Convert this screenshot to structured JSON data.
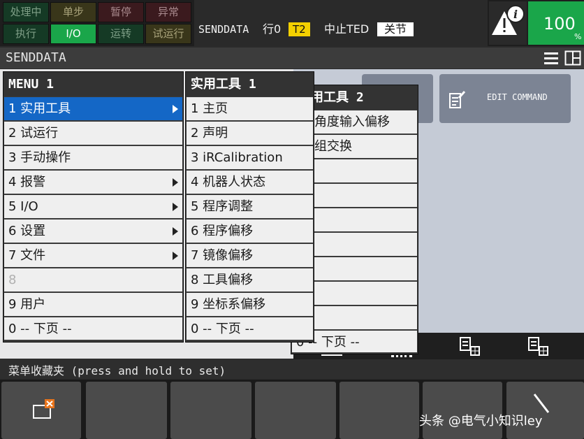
{
  "status": {
    "leds": [
      {
        "label": "处理中",
        "state": "off",
        "color": "green"
      },
      {
        "label": "单步",
        "state": "off",
        "color": "yellow"
      },
      {
        "label": "暂停",
        "state": "off",
        "color": "red"
      },
      {
        "label": "异常",
        "state": "off",
        "color": "red"
      },
      {
        "label": "执行",
        "state": "off",
        "color": "green"
      },
      {
        "label": "I/O",
        "state": "on",
        "color": "green"
      },
      {
        "label": "运转",
        "state": "off",
        "color": "green"
      },
      {
        "label": "试运行",
        "state": "off",
        "color": "yellow"
      }
    ],
    "program": "SENDDATA",
    "line": "行0",
    "mode": "T2",
    "state": "中止TED",
    "joint": "关节",
    "override": "100",
    "override_unit": "%"
  },
  "title": "SENDDATA",
  "menu": {
    "header": "MENU  1",
    "items": [
      "1 实用工具",
      "2 试运行",
      "3 手动操作",
      "4 报警",
      "5 I/O",
      "6 设置",
      "7 文件",
      "8",
      "9 用户",
      "0 -- 下页 --"
    ]
  },
  "submenu1": {
    "header": "实用工具  1",
    "items": [
      "1 主页",
      "2 声明",
      "3 iRCalibration",
      "4 机器人状态",
      "5 程序调整",
      "6 程序偏移",
      "7 镜像偏移",
      "8 工具偏移",
      "9 坐标系偏移",
      "0 -- 下页 --"
    ]
  },
  "submenu2": {
    "header": "用工具  2",
    "items": [
      "角度输入偏移",
      "组交换",
      "",
      "",
      "",
      "",
      "",
      "",
      "",
      "0 -- 下页 --"
    ]
  },
  "tiles": {
    "edit_command": "EDIT COMMAND"
  },
  "favorites": "菜单收藏夹 (press and hold to set)",
  "watermark": "头条 @电气小知识ley",
  "colors": {
    "selected": "#1467c6",
    "io_on": "#1aa64a",
    "mode_badge": "#f4d000"
  }
}
